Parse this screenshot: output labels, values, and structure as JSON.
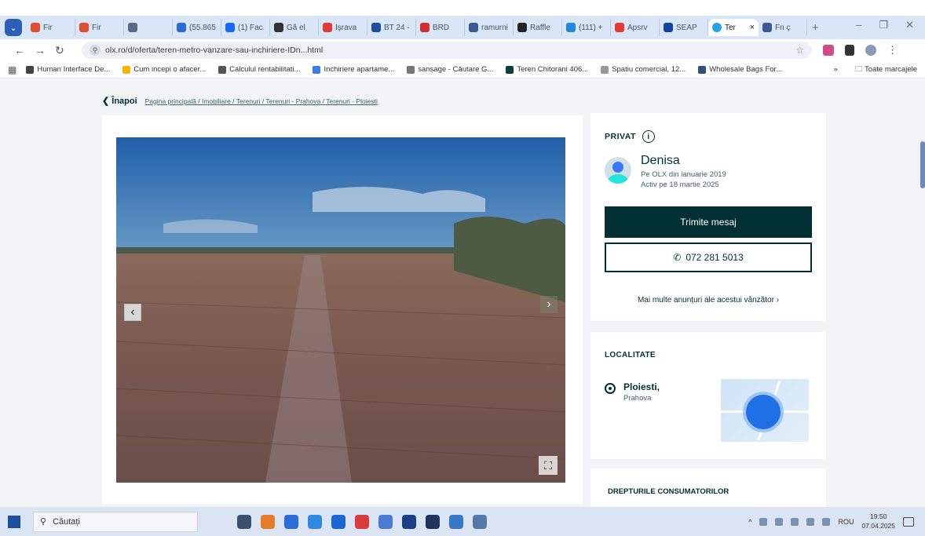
{
  "browser": {
    "tabs": [
      {
        "label": "Fir",
        "color": "#e04e2d"
      },
      {
        "label": "Fir",
        "color": "#e04e2d"
      },
      {
        "label": "",
        "color": "#5a6b88"
      },
      {
        "label": "(55.865",
        "color": "#2a6dd9"
      },
      {
        "label": "(1) Fac",
        "color": "#1769ff"
      },
      {
        "label": "Gă el",
        "color": "#333333"
      },
      {
        "label": "Işrava",
        "color": "#e53935"
      },
      {
        "label": "BT 24 -",
        "color": "#1c4fa1"
      },
      {
        "label": "BRD",
        "color": "#d32f2f"
      },
      {
        "label": "ramurni",
        "color": "#3b5998"
      },
      {
        "label": "Raffle",
        "color": "#222222"
      },
      {
        "label": "(111) +",
        "color": "#1e88e5"
      },
      {
        "label": "Apsrv",
        "color": "#e53935"
      },
      {
        "label": "SEAP",
        "color": "#0d47a1"
      }
    ],
    "active_tab": {
      "label": "Ter",
      "close": "×"
    },
    "extra_tab": {
      "label": "Fn ç",
      "color": "#3b5998"
    },
    "url": "olx.ro/d/oferta/teren-metro-vanzare-sau-inchiriere-IDn...html",
    "bookmarks": [
      {
        "label": "Human Interface De...",
        "color": "#444444"
      },
      {
        "label": "Cum incepi o afacer...",
        "color": "#f4b400"
      },
      {
        "label": "Calculul rentabilitati...",
        "color": "#555555"
      },
      {
        "label": "Inchiriere apartame...",
        "color": "#3d7de0"
      },
      {
        "label": "sansage - Căutare G...",
        "color": "#777777"
      },
      {
        "label": "Teren Chitorani 406...",
        "color": "#0f3d3e"
      },
      {
        "label": "Spatiu comercial, 12...",
        "color": "#999999"
      },
      {
        "label": "Wholesale Bags For...",
        "color": "#2f4f7f"
      }
    ],
    "bookmarks_overflow": "»",
    "all_bookmarks": "Toate marcajele"
  },
  "page": {
    "back_label": "Înapoi",
    "breadcrumb": "Pagina principală / Imobiliare / Terenuri / Terenuri - Prahova / Terenuri - Ploiesti",
    "seller": {
      "type_label": "PRIVAT",
      "name": "Denisa",
      "since": "Pe OLX din ianuarie 2019",
      "active": "Activ pe 18 martie 2025",
      "message_button": "Trimite mesaj",
      "phone": "072 281 5013",
      "more_ads": "Mai multe anunțuri ale acestui vânzător"
    },
    "location": {
      "title": "LOCALITATE",
      "city": "Ploiesti,",
      "county": "Prahova"
    },
    "rights_title": "DREPTURILE CONSUMATORILOR"
  },
  "taskbar": {
    "search_label": "Căutați",
    "language": "ROU",
    "time": "19:50",
    "date": "07.04.2025",
    "app_colors": [
      "#3b4f6e",
      "#e57c2a",
      "#2b6fd6",
      "#2f8ae0",
      "#1c66d1",
      "#d93a3a",
      "#4a7bd0",
      "#1a3f86",
      "#21335c",
      "#3a77c8",
      "#5577aa"
    ]
  },
  "colors": {
    "olx_dark": "#002f34",
    "tab_strip": "#d9e6f7",
    "page_bg": "#f2f4f5"
  }
}
